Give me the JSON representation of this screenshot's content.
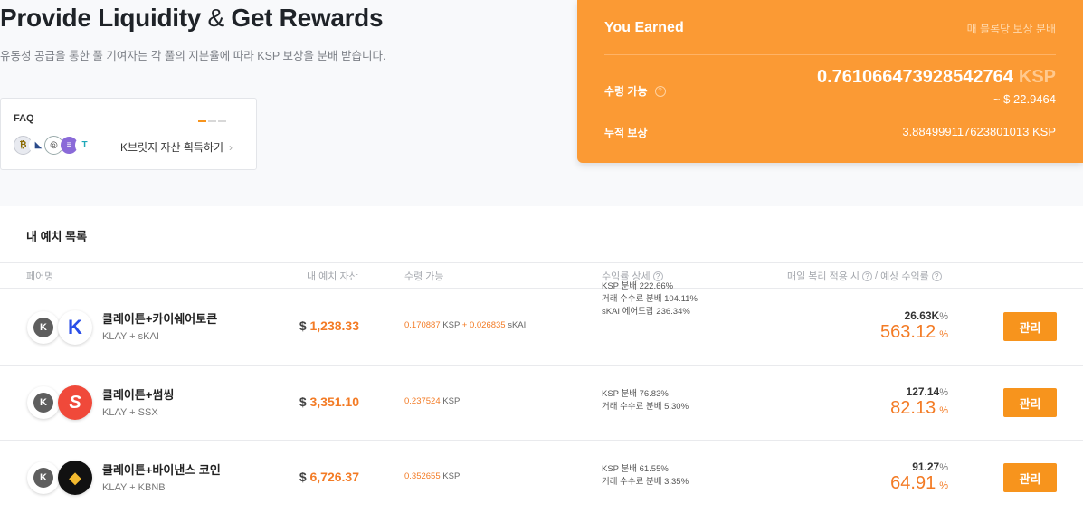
{
  "header": {
    "title_a": "Provide Liquidity",
    "title_amp": "&",
    "title_b": "Get Rewards",
    "subtitle": "유동성 공급을 통한 풀 기여자는 각 풀의 지분율에 따라 KSP 보상을 분배 받습니다."
  },
  "faq": {
    "title": "FAQ",
    "link_label": "K브릿지 자산 획득하기",
    "chevron": "›",
    "coins": [
      "coin-a-icon",
      "coin-b-icon",
      "coin-c-icon",
      "coin-d-icon",
      "coin-e-icon"
    ]
  },
  "earned": {
    "title": "You Earned",
    "note": "매 블록당 보상 분배",
    "claimable_label": "수령 가능",
    "claimable_value": "0.761066473928542764",
    "claimable_unit": "KSP",
    "claimable_usd": "~ $ 22.9464",
    "accumulated_label": "누적 보상",
    "accumulated_value": "3.884999117623801013 KSP",
    "colors": {
      "card": "#fb9a34"
    }
  },
  "deposits": {
    "title": "내 예치 목록",
    "columns": {
      "pair": "페어명",
      "my_deposit": "내 예치 자산",
      "claimable": "수령 가능",
      "yield_detail": "수익률 상세",
      "apr": "매일 복리 적용 시",
      "apr_sep": "/",
      "expected": "예상 수익률"
    },
    "rows": [
      {
        "name": "클레이튼+카이쉐어토큰",
        "symbol": "KLAY + sKAI",
        "deposit_prefix": "$",
        "deposit": "1,238.33",
        "claim_a": "0.170887",
        "claim_a_unit": "KSP",
        "claim_plus": "+",
        "claim_b": "0.026835",
        "claim_b_unit": "sKAI",
        "details": [
          "KSP 분배 222.66%",
          "거래 수수료 분배 104.11%",
          "sKAI 에어드랍 236.34%"
        ],
        "apr_small": "26.63K",
        "apr_big": "563.12",
        "pct": "%",
        "token_a": "K",
        "token_b": "K",
        "token_b_icon": "skai-token-icon",
        "button": "관리"
      },
      {
        "name": "클레이튼+썸씽",
        "symbol": "KLAY + SSX",
        "deposit_prefix": "$",
        "deposit": "3,351.10",
        "claim_a": "0.237524",
        "claim_a_unit": "KSP",
        "details": [
          "KSP 분배 76.83%",
          "거래 수수료 분배 5.30%"
        ],
        "apr_small": "127.14",
        "apr_big": "82.13",
        "pct": "%",
        "token_a": "K",
        "token_b": "S",
        "token_b_icon": "ssx-token-icon",
        "button": "관리"
      },
      {
        "name": "클레이튼+바이낸스 코인",
        "symbol": "KLAY + KBNB",
        "deposit_prefix": "$",
        "deposit": "6,726.37",
        "claim_a": "0.352655",
        "claim_a_unit": "KSP",
        "details": [
          "KSP 분배 61.55%",
          "거래 수수료 분배 3.35%"
        ],
        "apr_small": "91.27",
        "apr_big": "64.91",
        "pct": "%",
        "token_a": "K",
        "token_b": "◆",
        "token_b_icon": "kbnb-token-icon",
        "button": "관리"
      }
    ]
  }
}
